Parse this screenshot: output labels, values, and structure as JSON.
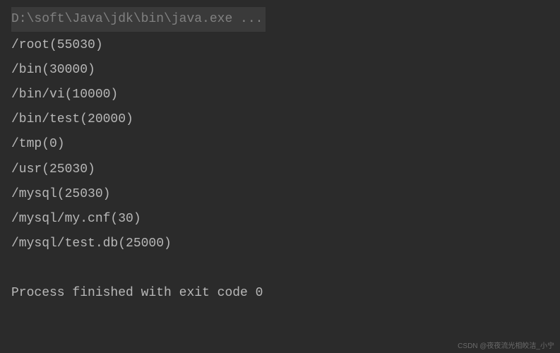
{
  "console": {
    "command": "D:\\soft\\Java\\jdk\\bin\\java.exe ...",
    "lines": [
      "/root(55030)",
      "/bin(30000)",
      "/bin/vi(10000)",
      "/bin/test(20000)",
      "/tmp(0)",
      "/usr(25030)",
      "/mysql(25030)",
      "/mysql/my.cnf(30)",
      "/mysql/test.db(25000)",
      "",
      "Process finished with exit code 0"
    ]
  },
  "watermark": "CSDN @夜夜流光相皎洁_小宁"
}
